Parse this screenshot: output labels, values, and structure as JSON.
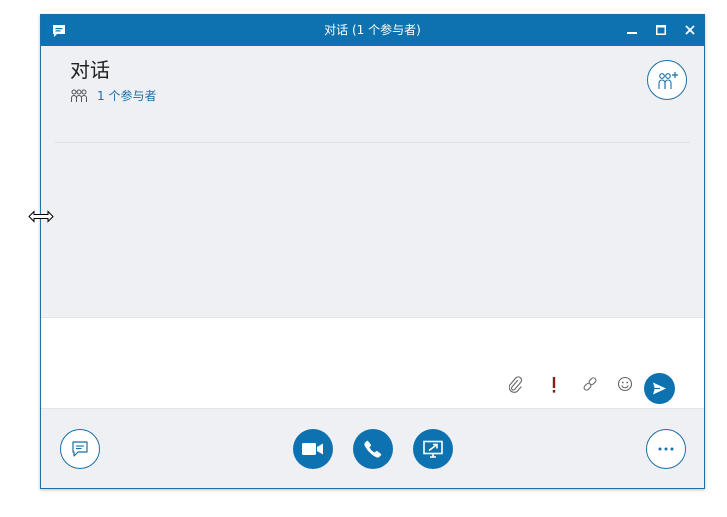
{
  "window": {
    "title": "对话 (1 个参与者)"
  },
  "header": {
    "title": "对话",
    "participants_label": "1 个参与者"
  },
  "compose": {
    "placeholder": ""
  },
  "icons": {
    "app": "chat-bubble-icon",
    "participants": "people-group-icon",
    "add_people": "add-people-icon",
    "attach": "paperclip-icon",
    "important": "exclamation-icon",
    "link": "link-icon",
    "emoji": "smiley-icon",
    "send": "send-arrow-icon",
    "im": "message-bubble-icon",
    "video": "video-camera-icon",
    "call": "phone-icon",
    "present": "present-screen-icon",
    "more": "ellipsis-icon",
    "cursor": "resize-horizontal-cursor"
  },
  "colors": {
    "accent": "#0e72b1",
    "link": "#1a6fa6",
    "important": "#8b1a1a",
    "background": "#eef0f4"
  }
}
